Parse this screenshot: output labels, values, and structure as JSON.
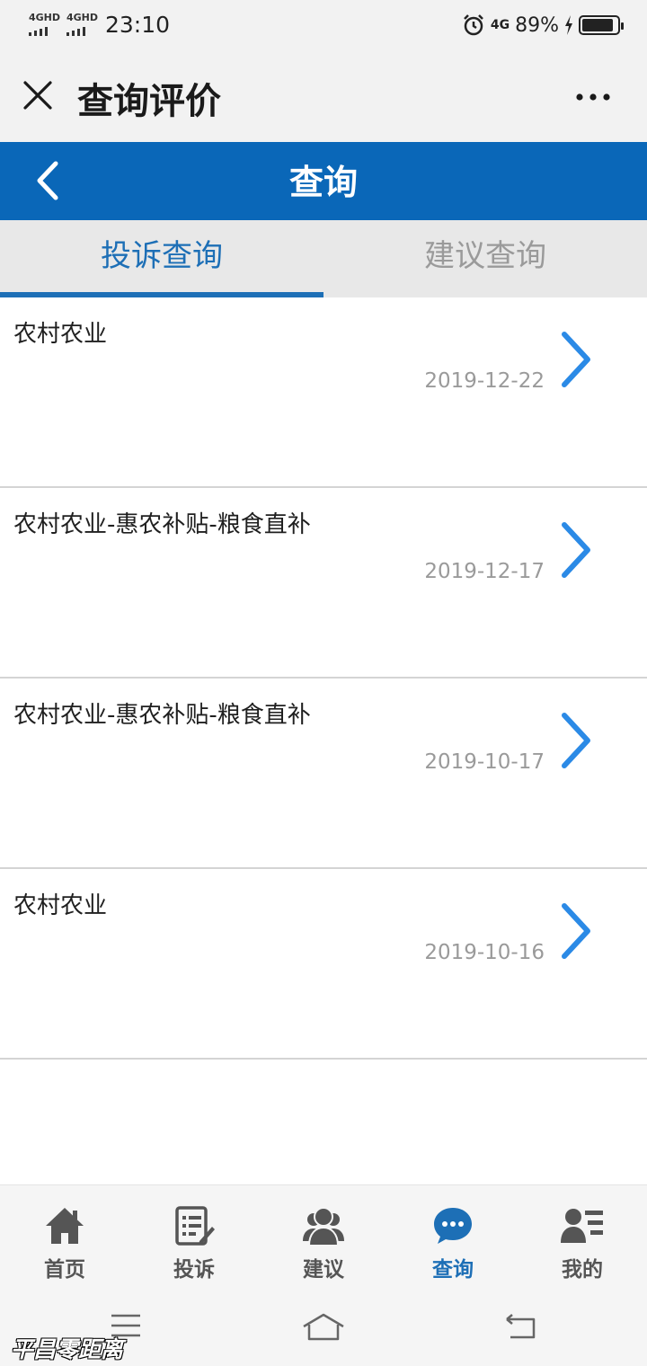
{
  "status_bar": {
    "signal1": "4GHD",
    "signal2": "4GHD",
    "time": "23:10",
    "network": "4G",
    "battery": "89%",
    "battery_level": 0.89
  },
  "titlebar": {
    "title": "查询评价"
  },
  "header": {
    "title": "查询"
  },
  "tabs": [
    {
      "label": "投诉查询",
      "active": true
    },
    {
      "label": "建议查询",
      "active": false
    }
  ],
  "list": [
    {
      "title": "农村农业",
      "date": "2019-12-22"
    },
    {
      "title": "农村农业-惠农补贴-粮食直补",
      "date": "2019-12-17"
    },
    {
      "title": "农村农业-惠农补贴-粮食直补",
      "date": "2019-10-17"
    },
    {
      "title": "农村农业",
      "date": "2019-10-16"
    }
  ],
  "bottom_nav": [
    {
      "label": "首页",
      "icon": "home-icon",
      "active": false
    },
    {
      "label": "投诉",
      "icon": "complaint-icon",
      "active": false
    },
    {
      "label": "建议",
      "icon": "users-icon",
      "active": false
    },
    {
      "label": "查询",
      "icon": "chat-icon",
      "active": true
    },
    {
      "label": "我的",
      "icon": "profile-icon",
      "active": false
    }
  ],
  "watermark": "平昌零距离",
  "colors": {
    "primary": "#0a67b8",
    "accent": "#1d6fb6",
    "chevron": "#2b8ae6"
  }
}
